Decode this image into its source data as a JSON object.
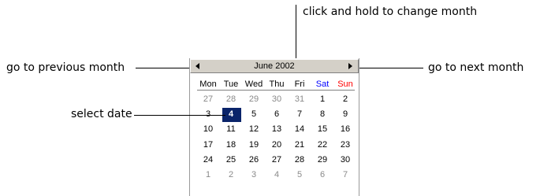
{
  "callouts": {
    "top": "click and hold to change month",
    "left": "go to previous month",
    "right": "go to next month",
    "select": "select date"
  },
  "calendar": {
    "month_label": "June 2002",
    "day_names": [
      "Mon",
      "Tue",
      "Wed",
      "Thu",
      "Fri",
      "Sat",
      "Sun"
    ],
    "weeks": [
      [
        "27",
        "28",
        "29",
        "30",
        "31",
        "1",
        "2"
      ],
      [
        "3",
        "4",
        "5",
        "6",
        "7",
        "8",
        "9"
      ],
      [
        "10",
        "11",
        "12",
        "13",
        "14",
        "15",
        "16"
      ],
      [
        "17",
        "18",
        "19",
        "20",
        "21",
        "22",
        "23"
      ],
      [
        "24",
        "25",
        "26",
        "27",
        "28",
        "29",
        "30"
      ],
      [
        "1",
        "2",
        "3",
        "4",
        "5",
        "6",
        "7"
      ]
    ],
    "other_month_cells": [
      [
        0,
        0
      ],
      [
        0,
        1
      ],
      [
        0,
        2
      ],
      [
        0,
        3
      ],
      [
        0,
        4
      ],
      [
        5,
        0
      ],
      [
        5,
        1
      ],
      [
        5,
        2
      ],
      [
        5,
        3
      ],
      [
        5,
        4
      ],
      [
        5,
        5
      ],
      [
        5,
        6
      ]
    ],
    "selected_cell": [
      1,
      1
    ],
    "colors": {
      "selected_bg": "#0a246a",
      "saturday": "#0000ff",
      "sunday": "#ff0000",
      "other_month": "#8a8a8a",
      "header_bg": "#d4d0c8"
    }
  },
  "icons": {
    "prev": "triangle-left-icon",
    "next": "triangle-right-icon"
  }
}
